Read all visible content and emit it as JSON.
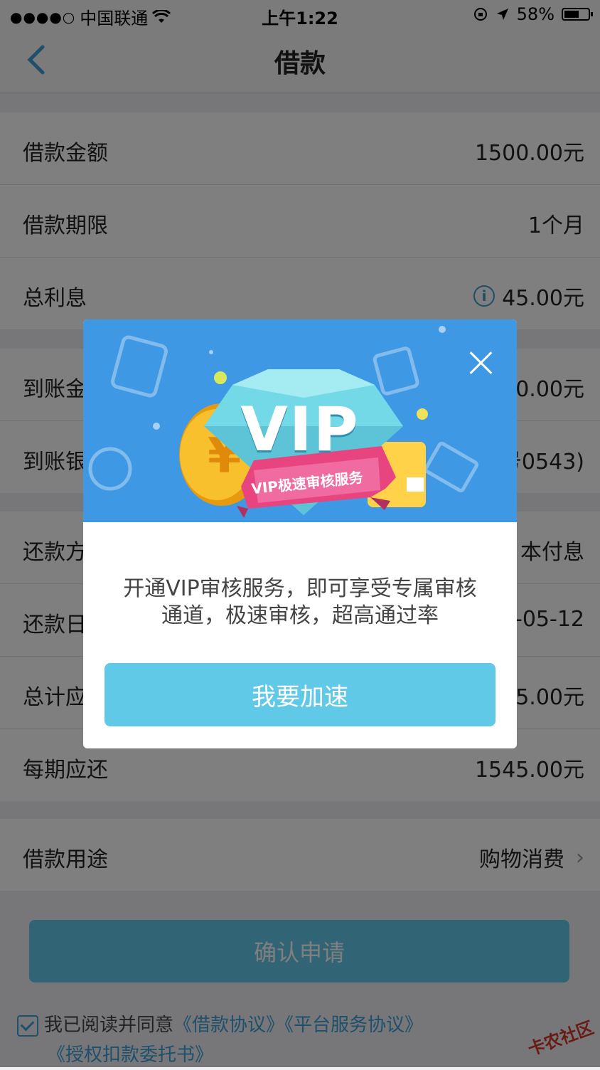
{
  "status_bar": {
    "signal": "●●●●○",
    "carrier": "中国联通",
    "time": "上午1:22",
    "battery": "58%"
  },
  "nav": {
    "title": "借款"
  },
  "group1": [
    {
      "label": "借款金额",
      "value": "1500.00元"
    },
    {
      "label": "借款期限",
      "value": "1个月"
    },
    {
      "label": "总利息",
      "value": "45.00元"
    }
  ],
  "group2": [
    {
      "label": "到账金",
      "value": "0.00元"
    },
    {
      "label": "到账银",
      "value": "号0543)"
    }
  ],
  "group3": [
    {
      "label": "还款方",
      "value": "本付息"
    },
    {
      "label": "还款日",
      "value": "-05-12"
    },
    {
      "label": "总计应",
      "value": "5.00元"
    },
    {
      "label": "每期应还",
      "value": "1545.00元"
    }
  ],
  "group4": [
    {
      "label": "借款用途",
      "value": "购物消费"
    }
  ],
  "confirm_button": "确认申请",
  "agreement": {
    "prefix": "我已阅读并同意",
    "link1": "《借款协议》",
    "link2": "《平台服务协议》",
    "link3": "《授权扣款委托书》"
  },
  "watermark": "卡农社区",
  "modal": {
    "vip_text": "VIP",
    "ribbon_text": "VIP极速审核服务",
    "description_line1": "开通VIP审核服务，即可享受专属审核",
    "description_line2": "通道，极速审核，超高通过率",
    "button": "我要加速"
  }
}
